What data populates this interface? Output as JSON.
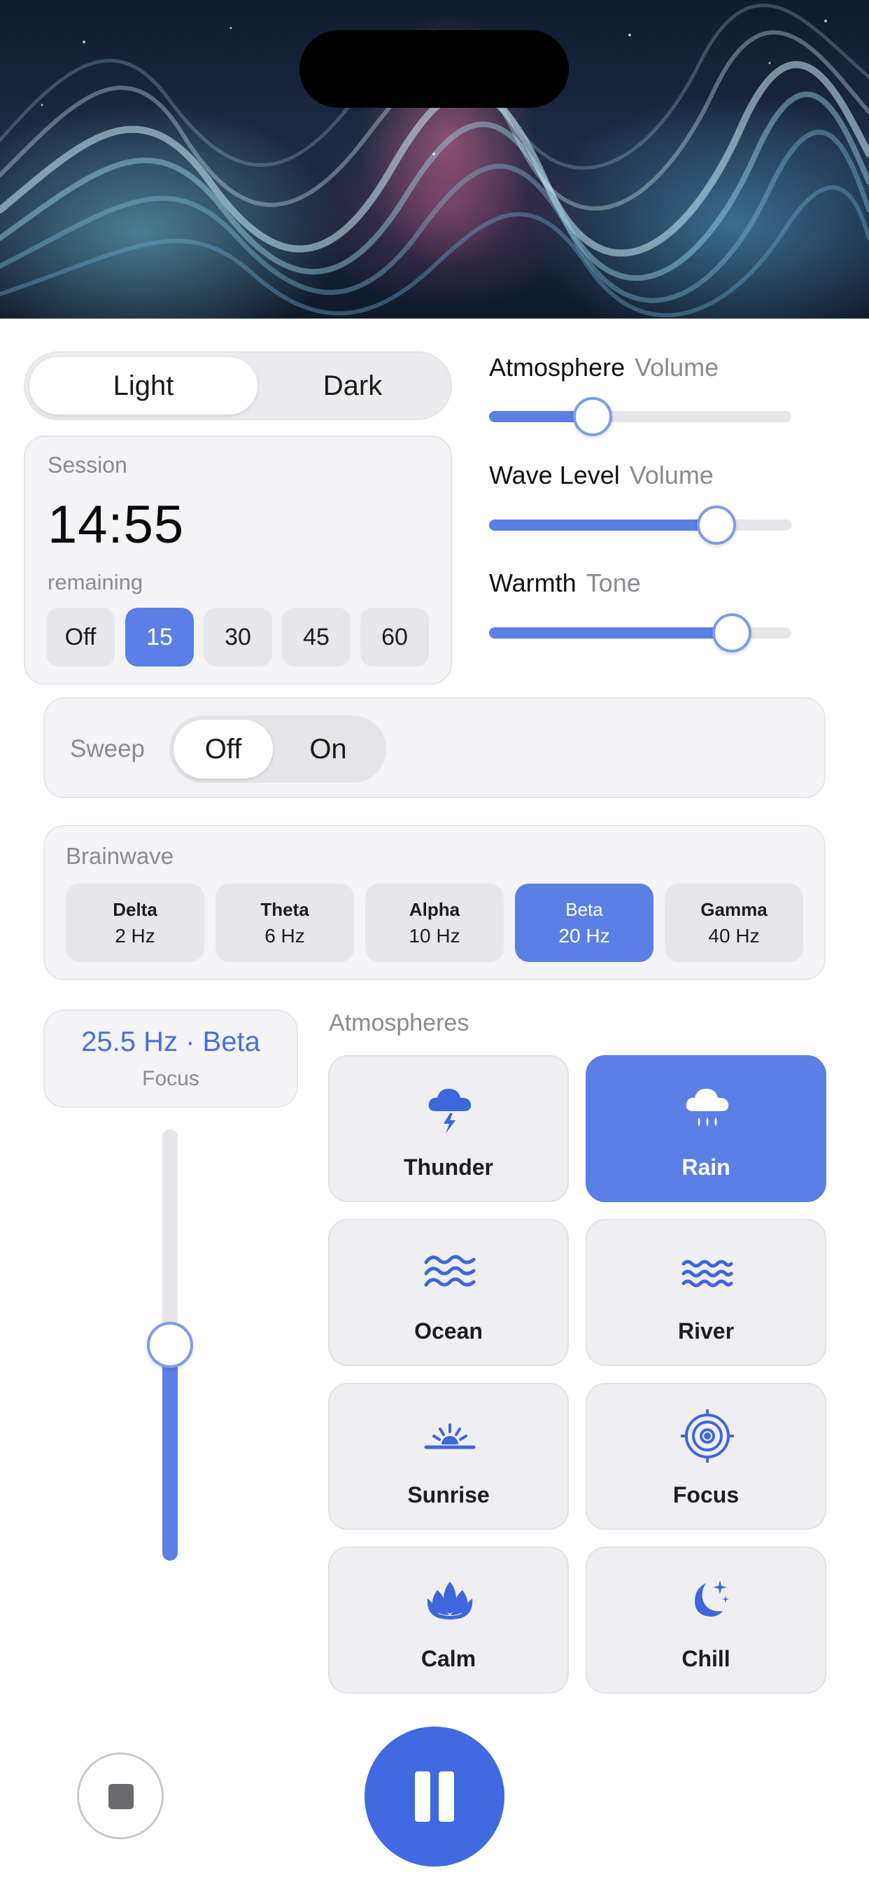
{
  "theme_toggle": {
    "options": [
      "Light",
      "Dark"
    ],
    "selected": "Light"
  },
  "session": {
    "label": "Session",
    "time": "14:55",
    "remaining_label": "remaining",
    "durations": [
      "Off",
      "15",
      "30",
      "45",
      "60"
    ],
    "selected_duration": "15"
  },
  "sliders": [
    {
      "label": "Atmosphere",
      "sublabel": "Volume",
      "value": 0.34
    },
    {
      "label": "Wave Level",
      "sublabel": "Volume",
      "value": 0.75
    },
    {
      "label": "Warmth",
      "sublabel": "Tone",
      "value": 0.8
    }
  ],
  "sweep": {
    "label": "Sweep",
    "options": [
      "Off",
      "On"
    ],
    "selected": "Off"
  },
  "brainwave": {
    "title": "Brainwave",
    "bands": [
      {
        "name": "Delta",
        "hz": "2 Hz"
      },
      {
        "name": "Theta",
        "hz": "6 Hz"
      },
      {
        "name": "Alpha",
        "hz": "10 Hz"
      },
      {
        "name": "Beta",
        "hz": "20 Hz"
      },
      {
        "name": "Gamma",
        "hz": "40 Hz"
      }
    ],
    "selected": "Beta"
  },
  "frequency": {
    "value": "25.5 Hz · Beta",
    "mode": "Focus",
    "level": 0.5
  },
  "atmospheres": {
    "title": "Atmospheres",
    "items": [
      {
        "label": "Thunder",
        "icon": "thunder-cloud-icon"
      },
      {
        "label": "Rain",
        "icon": "rain-cloud-icon"
      },
      {
        "label": "Ocean",
        "icon": "ocean-waves-icon"
      },
      {
        "label": "River",
        "icon": "river-waves-icon"
      },
      {
        "label": "Sunrise",
        "icon": "sunrise-icon"
      },
      {
        "label": "Focus",
        "icon": "target-icon"
      },
      {
        "label": "Calm",
        "icon": "lotus-icon"
      },
      {
        "label": "Chill",
        "icon": "moon-stars-icon"
      }
    ],
    "selected": "Rain"
  },
  "playback": {
    "stop_icon": "stop-icon",
    "main_icon": "pause-icon"
  },
  "colors": {
    "accent": "#5b7fe5",
    "accent_dark": "#4169e1",
    "icon": "#3f66dc"
  }
}
